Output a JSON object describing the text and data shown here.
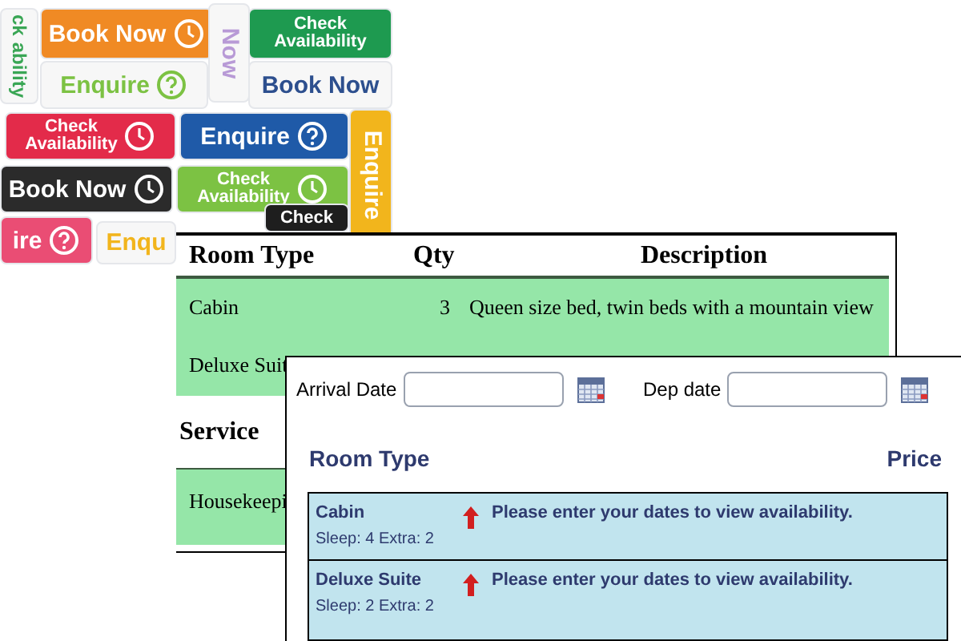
{
  "button_collage": {
    "tiles": [
      {
        "kind": "vertical-outline",
        "lines": [
          "ck",
          "ability"
        ],
        "color": "#3aa655"
      },
      {
        "kind": "filled-clock",
        "lines": [
          "Book Now"
        ],
        "color": "#f08a24"
      },
      {
        "kind": "vertical-outline",
        "lines": [
          "Now"
        ],
        "color": "#b89ad6"
      },
      {
        "kind": "filled",
        "lines": [
          "Check",
          "Availability"
        ],
        "color": "#1e9a50"
      },
      {
        "kind": "outline-question",
        "lines": [
          "Enquire"
        ],
        "color": "#7cc243"
      },
      {
        "kind": "outline",
        "lines": [
          "Book Now"
        ],
        "color": "#2d4f8e"
      },
      {
        "kind": "filled-clock",
        "lines": [
          "Check",
          "Availability"
        ],
        "color": "#e32b4a"
      },
      {
        "kind": "filled-question",
        "lines": [
          "Enquire"
        ],
        "color": "#1f5aa8"
      },
      {
        "kind": "vertical-filled",
        "lines": [
          "Enquire"
        ],
        "color": "#f2b51c"
      },
      {
        "kind": "filled-clock",
        "lines": [
          "Book Now"
        ],
        "color": "#2b2b2b"
      },
      {
        "kind": "filled-clock",
        "lines": [
          "Check",
          "Availability"
        ],
        "color": "#7cc243"
      },
      {
        "kind": "filled-question",
        "lines": [
          "ire"
        ],
        "color": "#ea4d74"
      },
      {
        "kind": "outline",
        "lines": [
          "Enqu"
        ],
        "color": "#f2b51c"
      },
      {
        "kind": "filled",
        "lines": [
          "Check"
        ],
        "color": "#1e1e1e"
      }
    ]
  },
  "rooms_table": {
    "columns": [
      "Room Type",
      "Qty",
      "Description"
    ],
    "rows": [
      {
        "cells": [
          "Cabin",
          "3",
          "Queen size bed, twin beds with a mountain view"
        ]
      },
      {
        "cells": [
          "Deluxe Suit"
        ]
      }
    ],
    "section": "Service",
    "section_rows": [
      {
        "cells": [
          "Housekeepi"
        ]
      }
    ]
  },
  "booking_form": {
    "fields": [
      {
        "label": "Arrival Date"
      },
      {
        "label": "Dep date"
      }
    ],
    "columns": [
      "Room Type",
      "Price"
    ],
    "rooms": [
      {
        "name": "Cabin",
        "capacity": "Sleep: 4 Extra: 2",
        "message": "Please enter your dates to view availability."
      },
      {
        "name": "Deluxe Suite",
        "capacity": "Sleep: 2 Extra: 2",
        "message": "Please enter your dates to view availability."
      }
    ]
  }
}
